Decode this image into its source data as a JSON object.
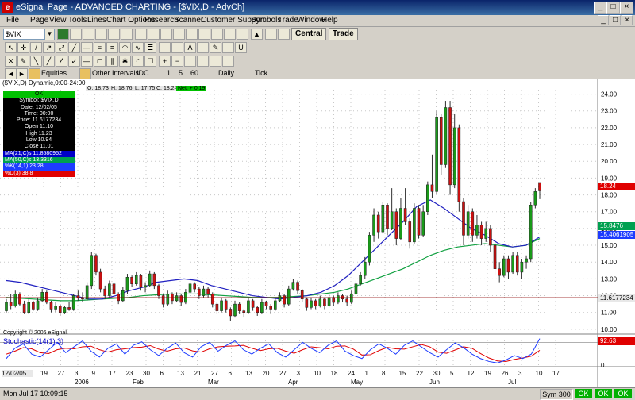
{
  "window": {
    "title": "eSignal Page - ADVANCED CHARTING - [$VIX,D - AdvCh]"
  },
  "menu": [
    "File",
    "Page",
    "View",
    "Tools",
    "Lines",
    "Chart Options",
    "Research",
    "Scanner",
    "Customer Support",
    "Symbols",
    "Trade",
    "Window",
    "Help"
  ],
  "toolbar": {
    "symbol": "$VIX",
    "central_label": "Central",
    "trade_label": "Trade"
  },
  "intervals": {
    "equities_label": "Equities",
    "other_label": "Other Intervals",
    "idc_label": "IDC",
    "values": [
      "1",
      "5",
      "60"
    ],
    "daily_label": "Daily",
    "tick_label": "Tick"
  },
  "chart": {
    "header_label": "($VIX,D) Dynamic,0:00-24:00",
    "ohlc": {
      "open": "O: 18.73",
      "high": "H: 18.76",
      "low": "L: 17.75",
      "close": "C: 18.24",
      "net": "Net: + 0.19"
    },
    "copyright": "Copyright © 2006 eSignal.",
    "price_axis": [
      "24.00",
      "23.00",
      "22.00",
      "21.00",
      "20.00",
      "19.00",
      "18.00",
      "17.00",
      "16.00",
      "15.00",
      "14.00",
      "13.00",
      "12.00",
      "11.00",
      "10.00"
    ],
    "price_tags": {
      "last": "18.24",
      "ma21": "15.8476",
      "ma50": "15.4061905",
      "cursor": "11.6177234"
    },
    "stoch_label": "Stochastic(14(1),3)",
    "stoch_tag": "92.63",
    "stoch_axis": "0",
    "date_first": "12/02/05",
    "date_labels": [
      "19",
      "27",
      "3",
      "9",
      "17",
      "23",
      "30",
      "6",
      "13",
      "21",
      "27",
      "6",
      "13",
      "20",
      "27",
      "3",
      "10",
      "18",
      "24",
      "1",
      "8",
      "15",
      "22",
      "30",
      "5",
      "12",
      "19",
      "26",
      "3",
      "10",
      "17"
    ],
    "month_labels": [
      "2006",
      "Feb",
      "Mar",
      "Apr",
      "May",
      "Jun",
      "Jul"
    ]
  },
  "info_box": {
    "status": "OK",
    "symbol": "Symbol: $VIX,D",
    "date": "Date: 12/02/05",
    "time": "Time: 00:00",
    "price": "Price: 11.6177234",
    "open": "Open 11.10",
    "high": "High 11.23",
    "low": "Low 10.94",
    "close": "Close 11.01",
    "ma21": "MA(21,C)s 11.8580952",
    "ma50": "MA(50,C)s 13.3316",
    "k": "%K(14,1) 23.28",
    "d": "%D(3) 38.8"
  },
  "status": {
    "left": "Mon Jul 17 10:09:15",
    "sym": "Sym 300",
    "ok1": "OK",
    "ok2": "OK",
    "ok3": "OK"
  },
  "colors": {
    "up": "#1a9a1a",
    "down": "#cc1010",
    "ma21": "#2020c0",
    "ma50": "#10a040",
    "k": "#1e3cff",
    "d": "#e00000"
  },
  "chart_data": {
    "type": "candlestick",
    "candles": [
      [
        11.1,
        11.8,
        11.0,
        11.6
      ],
      [
        11.6,
        12.1,
        11.2,
        11.4
      ],
      [
        11.4,
        12.3,
        11.3,
        12.1
      ],
      [
        12.1,
        12.2,
        11.4,
        11.5
      ],
      [
        11.5,
        11.7,
        10.9,
        11.0
      ],
      [
        11.0,
        11.8,
        10.9,
        11.6
      ],
      [
        11.6,
        11.7,
        11.1,
        11.2
      ],
      [
        11.2,
        11.9,
        11.1,
        11.7
      ],
      [
        11.7,
        12.4,
        11.6,
        12.2
      ],
      [
        12.2,
        12.3,
        11.5,
        11.6
      ],
      [
        11.6,
        11.7,
        11.0,
        11.2
      ],
      [
        11.2,
        11.6,
        11.0,
        11.4
      ],
      [
        11.4,
        11.5,
        10.8,
        11.0
      ],
      [
        11.0,
        11.4,
        10.9,
        11.3
      ],
      [
        11.3,
        11.6,
        11.1,
        11.2
      ],
      [
        11.2,
        12.1,
        11.1,
        12.0
      ],
      [
        12.0,
        12.3,
        11.7,
        11.9
      ],
      [
        11.9,
        12.2,
        11.6,
        11.8
      ],
      [
        11.8,
        12.8,
        11.7,
        12.6
      ],
      [
        12.6,
        14.6,
        12.4,
        14.4
      ],
      [
        14.4,
        14.5,
        13.2,
        13.4
      ],
      [
        13.4,
        13.6,
        12.2,
        12.4
      ],
      [
        12.4,
        12.6,
        11.8,
        12.0
      ],
      [
        12.0,
        12.9,
        11.9,
        12.7
      ],
      [
        12.7,
        12.8,
        11.9,
        12.1
      ],
      [
        12.1,
        12.2,
        11.5,
        11.7
      ],
      [
        11.7,
        12.5,
        11.6,
        12.3
      ],
      [
        12.3,
        13.3,
        12.1,
        13.1
      ],
      [
        13.1,
        13.2,
        12.5,
        12.7
      ],
      [
        12.7,
        13.4,
        12.6,
        13.2
      ],
      [
        13.2,
        13.3,
        12.3,
        12.5
      ],
      [
        12.5,
        12.8,
        12.2,
        12.6
      ],
      [
        12.6,
        13.5,
        12.5,
        13.3
      ],
      [
        13.3,
        13.4,
        12.4,
        12.6
      ],
      [
        12.6,
        12.7,
        11.8,
        12.0
      ],
      [
        12.0,
        12.1,
        11.3,
        11.5
      ],
      [
        11.5,
        12.3,
        11.4,
        12.1
      ],
      [
        12.1,
        12.2,
        11.5,
        11.7
      ],
      [
        11.7,
        12.2,
        11.6,
        12.0
      ],
      [
        12.0,
        12.1,
        11.4,
        11.6
      ],
      [
        11.6,
        12.4,
        11.5,
        12.2
      ],
      [
        12.2,
        12.9,
        12.1,
        12.7
      ],
      [
        12.7,
        12.8,
        12.2,
        12.4
      ],
      [
        12.4,
        12.5,
        11.8,
        12.0
      ],
      [
        12.0,
        12.6,
        11.9,
        12.4
      ],
      [
        12.4,
        12.5,
        11.9,
        12.1
      ],
      [
        12.1,
        12.2,
        11.3,
        11.5
      ],
      [
        11.5,
        11.6,
        10.9,
        11.1
      ],
      [
        11.1,
        11.9,
        11.0,
        11.7
      ],
      [
        11.7,
        11.8,
        11.0,
        11.2
      ],
      [
        11.2,
        11.3,
        10.5,
        10.8
      ],
      [
        10.8,
        11.7,
        10.7,
        11.5
      ],
      [
        11.5,
        11.6,
        10.9,
        11.1
      ],
      [
        11.1,
        11.2,
        10.7,
        11.0
      ],
      [
        11.0,
        11.9,
        10.9,
        11.7
      ],
      [
        11.7,
        11.8,
        11.1,
        11.3
      ],
      [
        11.3,
        11.4,
        10.8,
        11.0
      ],
      [
        11.0,
        11.8,
        10.9,
        11.6
      ],
      [
        11.6,
        11.7,
        11.2,
        11.4
      ],
      [
        11.4,
        11.5,
        10.9,
        11.2
      ],
      [
        11.2,
        11.9,
        11.1,
        11.7
      ],
      [
        11.7,
        12.2,
        11.6,
        12.0
      ],
      [
        12.0,
        12.1,
        11.3,
        11.5
      ],
      [
        11.5,
        12.6,
        11.4,
        12.4
      ],
      [
        12.4,
        13.0,
        12.3,
        12.8
      ],
      [
        12.8,
        12.9,
        12.1,
        12.3
      ],
      [
        12.3,
        12.4,
        11.6,
        11.8
      ],
      [
        11.8,
        11.9,
        11.1,
        11.3
      ],
      [
        11.3,
        11.9,
        11.2,
        11.7
      ],
      [
        11.7,
        11.8,
        11.2,
        11.4
      ],
      [
        11.4,
        12.0,
        11.3,
        11.8
      ],
      [
        11.8,
        11.9,
        11.2,
        11.4
      ],
      [
        11.4,
        12.1,
        11.3,
        11.9
      ],
      [
        11.9,
        12.0,
        11.4,
        11.6
      ],
      [
        11.6,
        12.2,
        11.5,
        12.0
      ],
      [
        12.0,
        12.1,
        11.6,
        11.8
      ],
      [
        11.8,
        12.0,
        11.4,
        11.6
      ],
      [
        11.6,
        12.3,
        11.5,
        12.1
      ],
      [
        12.1,
        12.9,
        12.0,
        12.7
      ],
      [
        12.7,
        13.4,
        12.6,
        13.2
      ],
      [
        13.2,
        14.3,
        13.0,
        14.0
      ],
      [
        14.0,
        15.8,
        13.8,
        15.6
      ],
      [
        15.6,
        17.2,
        15.2,
        16.8
      ],
      [
        16.8,
        17.0,
        15.4,
        15.8
      ],
      [
        15.8,
        17.6,
        15.7,
        17.4
      ],
      [
        17.4,
        17.5,
        15.6,
        16.0
      ],
      [
        16.0,
        18.4,
        15.9,
        17.0
      ],
      [
        17.0,
        17.2,
        15.0,
        15.4
      ],
      [
        15.4,
        17.8,
        15.3,
        17.2
      ],
      [
        17.2,
        18.4,
        16.2,
        16.4
      ],
      [
        16.4,
        16.6,
        14.8,
        15.2
      ],
      [
        15.2,
        17.5,
        15.1,
        17.2
      ],
      [
        17.2,
        17.4,
        15.4,
        15.6
      ],
      [
        15.6,
        17.4,
        15.5,
        17.0
      ],
      [
        17.0,
        18.8,
        16.8,
        18.6
      ],
      [
        18.6,
        20.4,
        17.8,
        18.2
      ],
      [
        18.2,
        23.0,
        18.0,
        22.6
      ],
      [
        22.6,
        22.8,
        19.2,
        19.8
      ],
      [
        19.8,
        23.6,
        19.6,
        23.2
      ],
      [
        23.2,
        23.6,
        18.0,
        18.6
      ],
      [
        18.6,
        22.8,
        18.4,
        22.0
      ],
      [
        22.0,
        22.2,
        17.0,
        17.6
      ],
      [
        17.6,
        17.8,
        15.0,
        15.6
      ],
      [
        15.6,
        17.4,
        15.4,
        17.0
      ],
      [
        17.0,
        17.2,
        15.2,
        15.6
      ],
      [
        15.6,
        16.8,
        15.4,
        16.2
      ],
      [
        16.2,
        16.4,
        15.0,
        15.4
      ],
      [
        15.4,
        16.4,
        15.2,
        16.0
      ],
      [
        16.0,
        16.2,
        14.6,
        15.0
      ],
      [
        15.0,
        15.4,
        13.2,
        13.6
      ],
      [
        13.6,
        14.0,
        12.8,
        13.2
      ],
      [
        13.2,
        14.4,
        13.1,
        14.2
      ],
      [
        14.2,
        14.4,
        13.0,
        13.4
      ],
      [
        13.4,
        14.6,
        13.3,
        14.4
      ],
      [
        14.4,
        14.6,
        13.2,
        13.4
      ],
      [
        13.4,
        14.2,
        13.0,
        14.0
      ],
      [
        14.0,
        14.4,
        13.6,
        14.2
      ],
      [
        14.2,
        17.6,
        14.0,
        17.4
      ],
      [
        17.4,
        18.4,
        17.2,
        18.2
      ],
      [
        18.73,
        18.76,
        17.75,
        18.24
      ]
    ],
    "ma21": [
      12.9,
      12.8,
      12.6,
      12.4,
      12.2,
      12.0,
      11.8,
      11.8,
      12.0,
      12.3,
      12.5,
      12.8,
      12.9,
      13.0,
      12.9,
      12.6,
      12.4,
      12.2,
      12.0,
      11.9,
      11.8,
      11.9,
      12.0,
      12.2,
      12.6,
      13.2,
      14.0,
      14.8,
      15.6,
      16.4,
      17.3,
      17.7,
      17.2,
      16.6,
      16.0,
      15.6,
      15.1,
      14.9,
      15.0,
      15.5
    ],
    "ma50": [
      11.9,
      11.85,
      11.8,
      11.75,
      11.7,
      11.7,
      11.75,
      11.8,
      11.85,
      11.9,
      12.0,
      12.05,
      12.1,
      12.1,
      12.1,
      12.05,
      12.0,
      11.95,
      11.9,
      11.9,
      11.9,
      11.95,
      12.0,
      12.1,
      12.2,
      12.4,
      12.7,
      13.0,
      13.3,
      13.6,
      14.0,
      14.4,
      14.7,
      14.9,
      15.0,
      15.1,
      15.0,
      14.9,
      15.0,
      15.4
    ],
    "stoch_k": [
      25,
      60,
      75,
      40,
      30,
      55,
      80,
      45,
      65,
      85,
      50,
      30,
      60,
      75,
      40,
      70,
      82,
      55,
      35,
      60,
      78,
      45,
      30,
      65,
      80,
      50,
      70,
      85,
      55,
      40,
      60,
      75,
      45,
      30,
      55,
      80,
      60,
      45,
      70,
      85,
      50,
      35,
      25,
      55,
      75,
      60,
      40,
      70,
      85,
      65,
      45,
      30,
      55,
      78,
      62,
      40,
      25,
      15,
      10,
      20,
      35,
      25,
      40,
      93
    ],
    "stoch_d": [
      40,
      50,
      62,
      58,
      45,
      42,
      55,
      60,
      58,
      65,
      67,
      55,
      47,
      55,
      58,
      62,
      64,
      69,
      57,
      50,
      58,
      61,
      51,
      47,
      58,
      65,
      67,
      68,
      70,
      60,
      52,
      58,
      60,
      50,
      43,
      55,
      65,
      62,
      58,
      67,
      68,
      57,
      37,
      38,
      52,
      63,
      58,
      57,
      65,
      73,
      65,
      47,
      43,
      54,
      65,
      60,
      42,
      27,
      17,
      15,
      22,
      27,
      33,
      53
    ]
  }
}
